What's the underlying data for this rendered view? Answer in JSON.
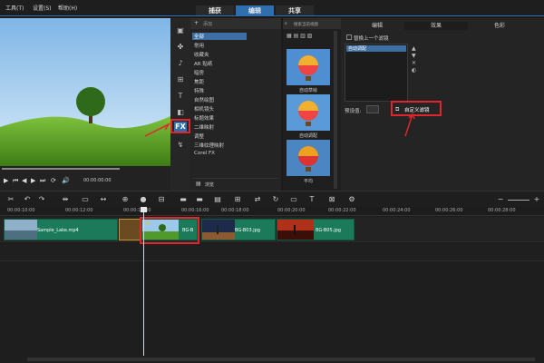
{
  "menu": {
    "items": [
      "工具(T)",
      "设置(S)",
      "帮助(H)"
    ]
  },
  "mode_tabs": [
    {
      "label": "捕获",
      "active": false
    },
    {
      "label": "编辑",
      "active": true
    },
    {
      "label": "共享",
      "active": false
    }
  ],
  "preview": {
    "timecode": "00:00:00:00"
  },
  "categories": {
    "header": "添加",
    "items": [
      "全部",
      "常用",
      "收藏夹",
      "AR 贴纸",
      "暗房",
      "焦距",
      "特殊",
      "自然绘图",
      "相机镜头",
      "标题效果",
      "二维映射",
      "调整",
      "三维纹理映射",
      "Corel FX"
    ],
    "selected_index": 0,
    "browse_label": "浏览"
  },
  "thumbs": {
    "header": "搜索当前视图",
    "items": [
      "自动草绘",
      "自动调配",
      "平均"
    ]
  },
  "properties": {
    "tabs": [
      "编辑",
      "效果",
      "色彩"
    ],
    "active_tab": 1,
    "replace_last": "替换上一个滤镜",
    "filter_list_item": "自动调配",
    "preset_label": "预设值:",
    "custom_filter_label": "自定义滤镜"
  },
  "ruler": {
    "ticks": [
      "00:00:10:00",
      "00:00:12:00",
      "00:00:14:00",
      "00:00:16:00",
      "00:00:18:00",
      "00:00:20:00",
      "00:00:22:00",
      "00:00:24:00",
      "00:00:26:00",
      "00:00:28:00"
    ]
  },
  "clips": [
    {
      "label": "Sample_Lake.mp4"
    },
    {
      "label": "BG-B"
    },
    {
      "label": "BG-B03.jpg"
    },
    {
      "label": "BG-B05.jpg"
    }
  ],
  "colors": {
    "accent": "#2f6fb0",
    "highlight": "#e0262a",
    "clip": "#1a7a5a"
  }
}
